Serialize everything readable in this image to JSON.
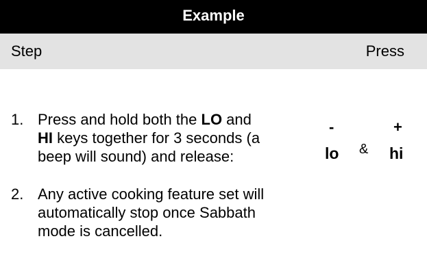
{
  "header": {
    "title": "Example"
  },
  "columns": {
    "step": "Step",
    "press": "Press"
  },
  "steps": [
    {
      "number": "1.",
      "text_before_lo": "Press and hold both the ",
      "lo": "LO",
      "text_and": " and ",
      "hi": "HI",
      "text_after_hi": " keys together for 3 seconds (a beep will sound) and release:"
    },
    {
      "number": "2.",
      "text": "Any active cooking feature set will automatically stop once Sabbath mode is cancelled."
    }
  ],
  "keys": {
    "lo_symbol": "-",
    "lo_label": "lo",
    "ampersand": "&",
    "hi_symbol": "+",
    "hi_label": "hi"
  }
}
